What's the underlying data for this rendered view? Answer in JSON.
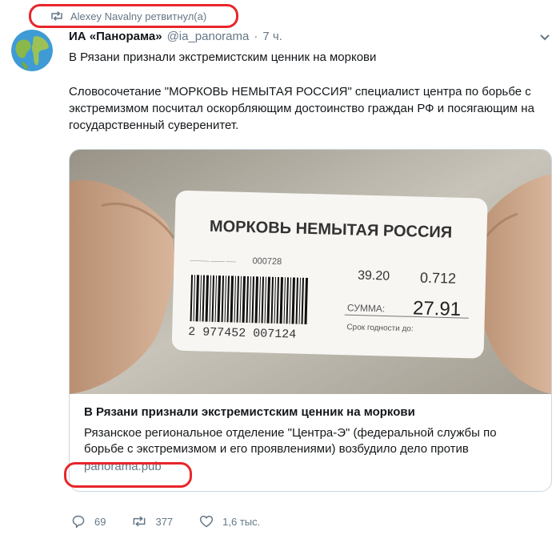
{
  "retweet": {
    "text": "Alexey Navalny ретвитнул(а)"
  },
  "tweet": {
    "author_name": "ИА «Панорама»",
    "author_handle": "@ia_panorama",
    "separator": "·",
    "time": "7 ч.",
    "title": "В Рязани признали экстремистским ценник на моркови",
    "body": "Словосочетание \"МОРКОВЬ НЕМЫТАЯ РОССИЯ\" специалист центра по борьбе с экстремизмом посчитал оскорбляющим достоинство граждан РФ и посягающим на государственный суверенитет."
  },
  "card": {
    "image": {
      "label_title": "МОРКОВЬ НЕМЫТАЯ РОССИЯ",
      "code": "000728",
      "price_per_kg": "39.20",
      "weight": "0.712",
      "sum_label": "СУММА:",
      "total": "27.91",
      "barcode": "2 977452 007124",
      "expiry_label": "Срок годности до:"
    },
    "title": "В Рязани признали экстремистским ценник на моркови",
    "description": "Рязанское региональное отделение \"Центра-Э\" (федеральной службы по борьбе с экстремизмом и его проявлениями) возбудило дело против",
    "domain": "panorama.pub"
  },
  "actions": {
    "reply_count": "69",
    "retweet_count": "377",
    "like_count": "1,6 тыс."
  },
  "colors": {
    "highlight": "#e8262b",
    "secondary_text": "#657786",
    "border": "#ccd6dd"
  },
  "icons": [
    "retweet-icon",
    "globe-avatar",
    "chevron-down-icon",
    "reply-icon",
    "like-icon"
  ]
}
